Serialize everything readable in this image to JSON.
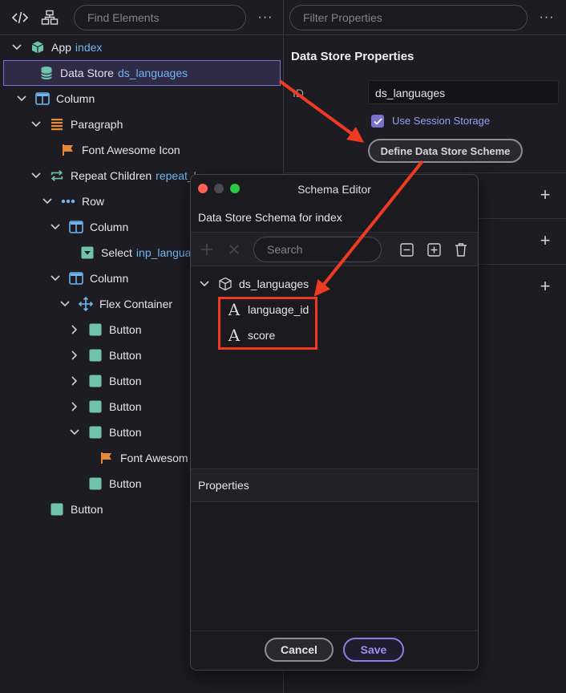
{
  "colors": {
    "accent": "#7b6fd0",
    "reference_text": "#6fb6ee",
    "annotation_red": "#ee3a22",
    "teal_icon": "#6fc2ad",
    "orange_icon": "#e8893a"
  },
  "left": {
    "search_placeholder": "Find Elements",
    "tree": [
      {
        "label": "App",
        "ref": "index",
        "icon": "cube-icon"
      },
      {
        "label": "Data Store",
        "ref": "ds_languages",
        "icon": "database-icon"
      },
      {
        "label": "Column",
        "ref": "",
        "icon": "column-icon"
      },
      {
        "label": "Paragraph",
        "ref": "",
        "icon": "paragraph-icon"
      },
      {
        "label": "Font Awesome Icon",
        "ref": "",
        "icon": "flag-icon"
      },
      {
        "label": "Repeat Children",
        "ref": "repeat_l",
        "icon": "repeat-icon"
      },
      {
        "label": "Row",
        "ref": "",
        "icon": "row-dots-icon"
      },
      {
        "label": "Column",
        "ref": "",
        "icon": "column-icon"
      },
      {
        "label": "Select",
        "ref": "inp_langua",
        "icon": "select-icon"
      },
      {
        "label": "Column",
        "ref": "",
        "icon": "column-icon"
      },
      {
        "label": "Flex Container",
        "ref": "",
        "icon": "move-arrows-icon"
      },
      {
        "label": "Button",
        "ref": "",
        "icon": "button-icon"
      },
      {
        "label": "Button",
        "ref": "",
        "icon": "button-icon"
      },
      {
        "label": "Button",
        "ref": "",
        "icon": "button-icon"
      },
      {
        "label": "Button",
        "ref": "",
        "icon": "button-icon"
      },
      {
        "label": "Button",
        "ref": "",
        "icon": "button-icon"
      },
      {
        "label": "Font Awesom",
        "ref": "",
        "icon": "flag-icon"
      },
      {
        "label": "Button",
        "ref": "",
        "icon": "button-icon"
      },
      {
        "label": "Button",
        "ref": "",
        "icon": "button-icon"
      }
    ]
  },
  "right": {
    "filter_placeholder": "Filter Properties",
    "title": "Data Store Properties",
    "id_label": "ID",
    "id_value": "ds_languages",
    "checkbox_label": "Use Session Storage",
    "checkbox_checked": true,
    "define_button": "Define Data Store Scheme"
  },
  "modal": {
    "title": "Schema Editor",
    "heading": "Data Store Schema for index",
    "search_placeholder": "Search",
    "root_node": "ds_languages",
    "fields": [
      "language_id",
      "score"
    ],
    "properties_label": "Properties",
    "cancel_label": "Cancel",
    "save_label": "Save"
  }
}
